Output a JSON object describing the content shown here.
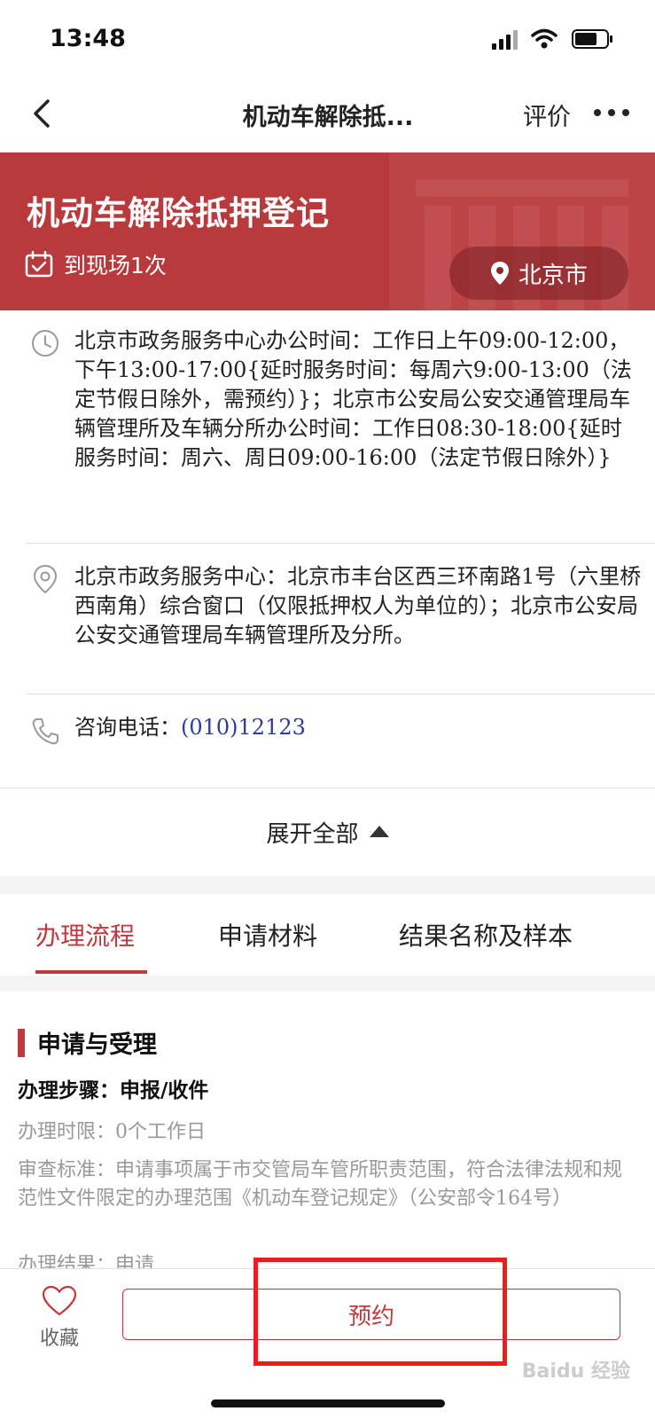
{
  "status_bar": {
    "time": "13:48"
  },
  "nav": {
    "title": "机动车解除抵...",
    "review": "评价"
  },
  "banner": {
    "title": "机动车解除抵押登记",
    "visit": "到现场1次",
    "city": "北京市"
  },
  "info": {
    "hours": "北京市政务服务中心办公时间：工作日上午09:00-12:00，下午13:00-17:00{延时服务时间：每周六9:00-13:00（法定节假日除外，需预约）}；北京市公安局公安交通管理局车辆管理所及车辆分所办公时间：工作日08:30-18:00{延时服务时间：周六、周日09:00-16:00（法定节假日除外）}",
    "address": "北京市政务服务中心：北京市丰台区西三环南路1号（六里桥西南角）综合窗口（仅限抵押权人为单位的）；北京市公安局公安交通管理局车辆管理所及分所。",
    "phone_label": "咨询电话：",
    "phone_number": "(010)12123"
  },
  "expand": {
    "label": "展开全部"
  },
  "tabs": [
    {
      "label": "办理流程",
      "active": true
    },
    {
      "label": "申请材料",
      "active": false
    },
    {
      "label": "结果名称及样本",
      "active": false
    }
  ],
  "process": {
    "section_title": "申请与受理",
    "step": "办理步骤：申报/收件",
    "time_limit": "办理时限：0个工作日",
    "criteria": "审查标准：申请事项属于市交管局车管所职责范围，符合法律法规和规范性文件限定的办理范围《机动车登记规定》（公安部令164号）",
    "result": "办理结果：申请"
  },
  "bottom": {
    "favorite": "收藏",
    "book": "预约"
  },
  "watermark": "Baidu 经验",
  "colors": {
    "brand_red": "#c0393c",
    "banner_red": "#b93a3d",
    "phone_blue": "#2e3c9a",
    "annotation_red": "#ee1c1c"
  },
  "icons": [
    "back-icon",
    "more-icon",
    "calendar-check-icon",
    "location-pin-icon",
    "clock-icon",
    "map-pin-icon",
    "phone-icon",
    "triangle-up-icon",
    "heart-icon",
    "signal-icon",
    "wifi-icon",
    "battery-icon"
  ]
}
